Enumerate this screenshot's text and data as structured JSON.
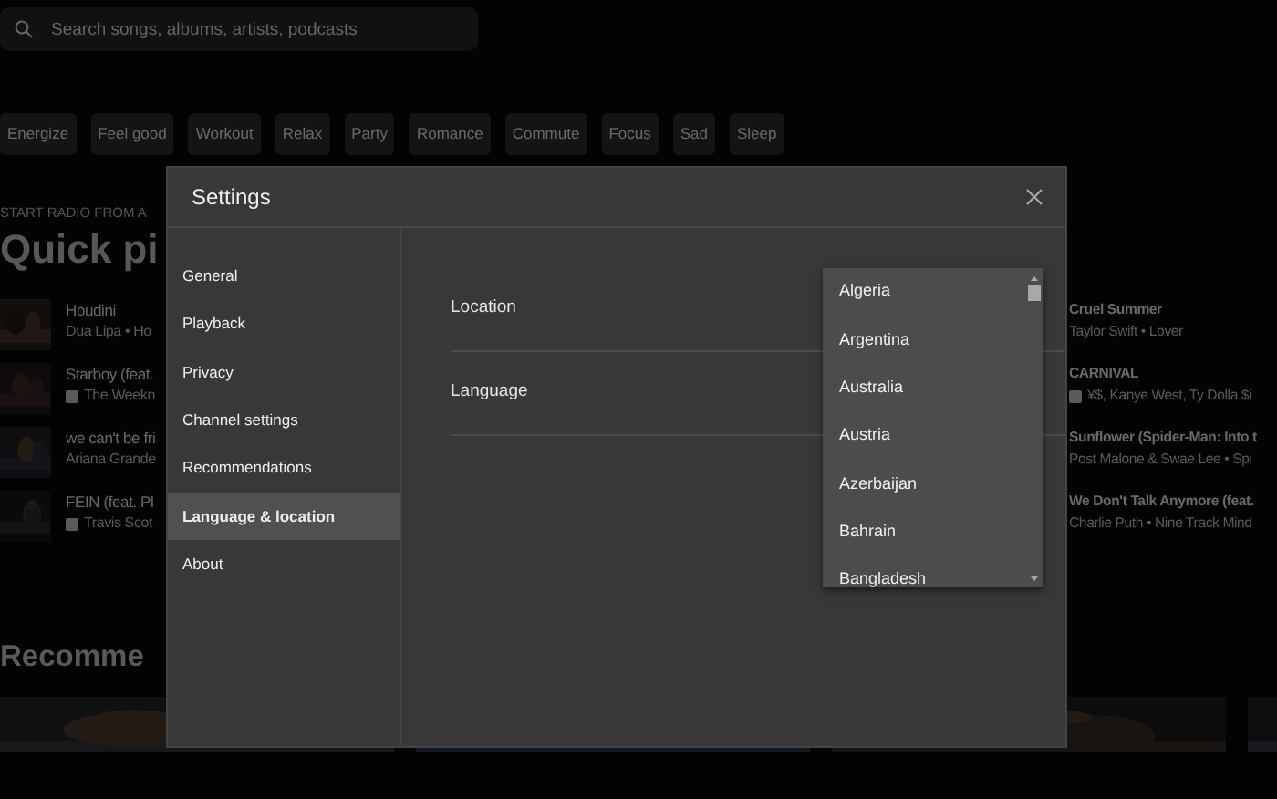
{
  "search": {
    "placeholder": "Search songs, albums, artists, podcasts"
  },
  "moods": [
    "Energize",
    "Feel good",
    "Workout",
    "Relax",
    "Party",
    "Romance",
    "Commute",
    "Focus",
    "Sad",
    "Sleep"
  ],
  "quick_picks": {
    "eyebrow": "START RADIO FROM A",
    "title": "Quick pi",
    "songs": [
      {
        "title": "Houdini",
        "subtitle": "Dua Lipa • Ho",
        "explicit": false
      },
      {
        "title": "Starboy (feat.",
        "subtitle": "The Weekn",
        "explicit": true
      },
      {
        "title": "we can't be fri",
        "subtitle": "Ariana Grande",
        "explicit": false
      },
      {
        "title": "FEIN (feat. Pl",
        "subtitle": "Travis Scot",
        "explicit": true
      }
    ],
    "more_songs": [
      {
        "title": "Cruel Summer",
        "subtitle": "Taylor Swift • Lover",
        "explicit": false
      },
      {
        "title": "CARNIVAL",
        "subtitle": "¥$, Kanye West, Ty Dolla $i",
        "explicit": true
      },
      {
        "title": "Sunflower (Spider-Man: Into t",
        "subtitle": "Post Malone & Swae Lee • Spi",
        "explicit": false
      },
      {
        "title": "We Don't Talk Anymore (feat.",
        "subtitle": "Charlie Puth • Nine Track Mind",
        "explicit": false
      }
    ]
  },
  "recommended": {
    "title": "Recomme"
  },
  "settings": {
    "title": "Settings",
    "nav": [
      {
        "label": "General",
        "selected": false
      },
      {
        "label": "Playback",
        "selected": false
      },
      {
        "label": "Privacy",
        "selected": false
      },
      {
        "label": "Channel settings",
        "selected": false
      },
      {
        "label": "Recommendations",
        "selected": false
      },
      {
        "label": "Language & location",
        "selected": true
      },
      {
        "label": "About",
        "selected": false
      }
    ],
    "rows": [
      {
        "label": "Location"
      },
      {
        "label": "Language"
      }
    ],
    "dropdown": {
      "options": [
        "Algeria",
        "Argentina",
        "Australia",
        "Austria",
        "Azerbaijan",
        "Bahrain",
        "Bangladesh"
      ]
    }
  }
}
